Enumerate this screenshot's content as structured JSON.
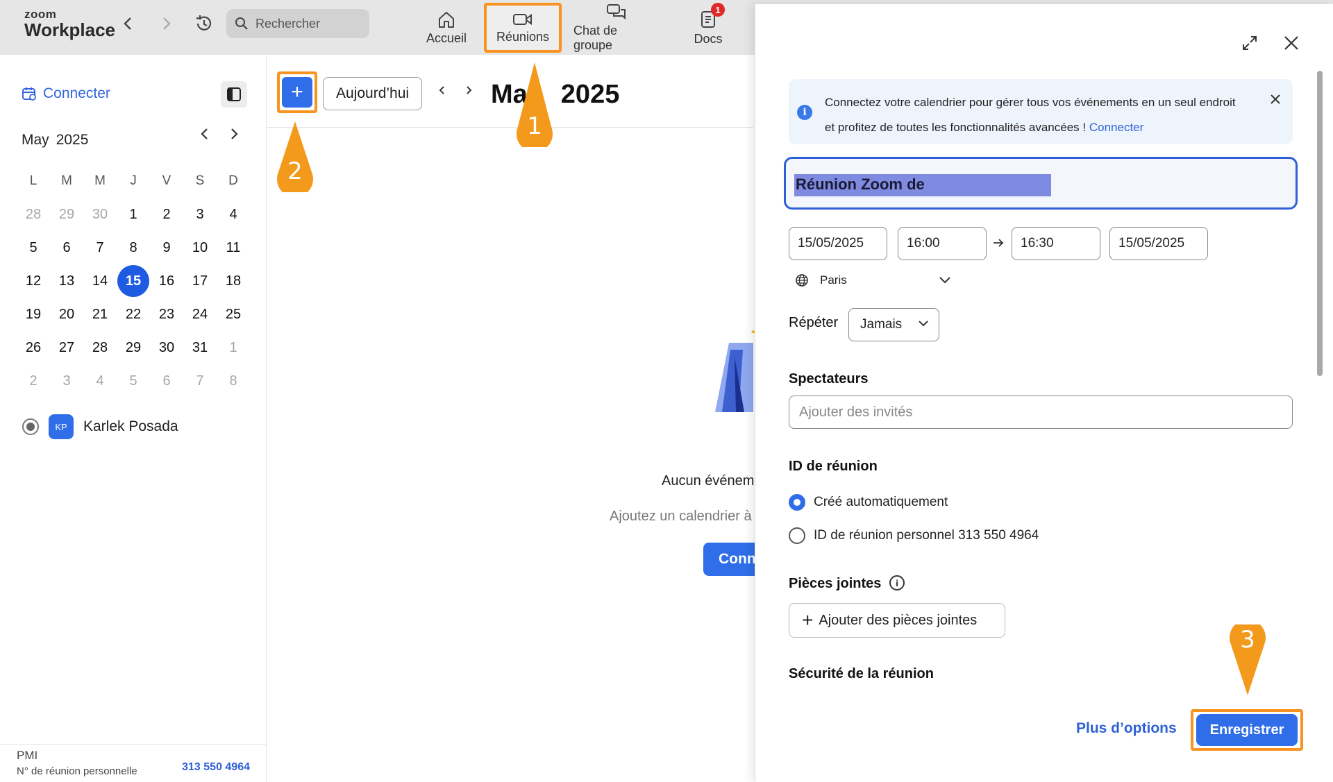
{
  "app": {
    "logo_line1": "zoom",
    "logo_line2": "Workplace",
    "search_placeholder": "Rechercher"
  },
  "nav_tabs": [
    {
      "label": "Accueil",
      "icon": "home-icon"
    },
    {
      "label": "Réunions",
      "icon": "video-camera-icon",
      "active": true
    },
    {
      "label": "Chat de groupe",
      "icon": "chat-bubbles-icon"
    },
    {
      "label": "Docs",
      "icon": "document-icon",
      "badge": "1"
    }
  ],
  "sidebar": {
    "connect_label": "Connecter",
    "month": "May",
    "year": "2025",
    "weekdays": [
      "L",
      "M",
      "M",
      "J",
      "V",
      "S",
      "D"
    ],
    "weeks": [
      [
        "28",
        "29",
        "30",
        "1",
        "2",
        "3",
        "4"
      ],
      [
        "5",
        "6",
        "7",
        "8",
        "9",
        "10",
        "11"
      ],
      [
        "12",
        "13",
        "14",
        "15",
        "16",
        "17",
        "18"
      ],
      [
        "19",
        "20",
        "21",
        "22",
        "23",
        "24",
        "25"
      ],
      [
        "26",
        "27",
        "28",
        "29",
        "30",
        "31",
        "1"
      ],
      [
        "2",
        "3",
        "4",
        "5",
        "6",
        "7",
        "8"
      ]
    ],
    "selected_day": "15",
    "owner_initials": "KP",
    "owner_name": "Karlek Posada",
    "pmi_label": "PMI",
    "pmi_sub": "N° de réunion personnelle",
    "pmi_number": "313 550 4964"
  },
  "main": {
    "add_label": "+",
    "today_label": "Aujourd’hui",
    "title_a": "Ma",
    "title_b": "2025",
    "empty_title": "Aucun événem",
    "empty_sub": "Ajoutez un calendrier à",
    "connect_btn": "Conn"
  },
  "panel": {
    "banner_text": "Connectez votre calendrier pour gérer tous vos événements en un seul endroit et profitez de toutes les fonctionnalités avancées ! ",
    "banner_link": "Connecter",
    "meeting_title": "Réunion Zoom de",
    "start_date": "15/05/2025",
    "start_time": "16:00",
    "end_time": "16:30",
    "end_date": "15/05/2025",
    "timezone": "Paris",
    "repeat_label": "Répéter",
    "repeat_value": "Jamais",
    "attendees_label": "Spectateurs",
    "attendees_placeholder": "Ajouter des invités",
    "meeting_id_label": "ID de réunion",
    "id_auto": "Créé automatiquement",
    "id_personal": "ID de réunion personnel 313 550 4964",
    "attachments_label": "Pièces jointes",
    "add_attachments": "Ajouter des pièces jointes",
    "security_label": "Sécurité de la réunion",
    "more_options": "Plus d’options",
    "save": "Enregistrer"
  },
  "annotations": [
    {
      "number": "1"
    },
    {
      "number": "2"
    },
    {
      "number": "3"
    }
  ],
  "colors": {
    "accent": "#2f6ee8",
    "highlight": "#f7931e",
    "topbar": "#e6e6e6",
    "badge": "#e02828"
  }
}
